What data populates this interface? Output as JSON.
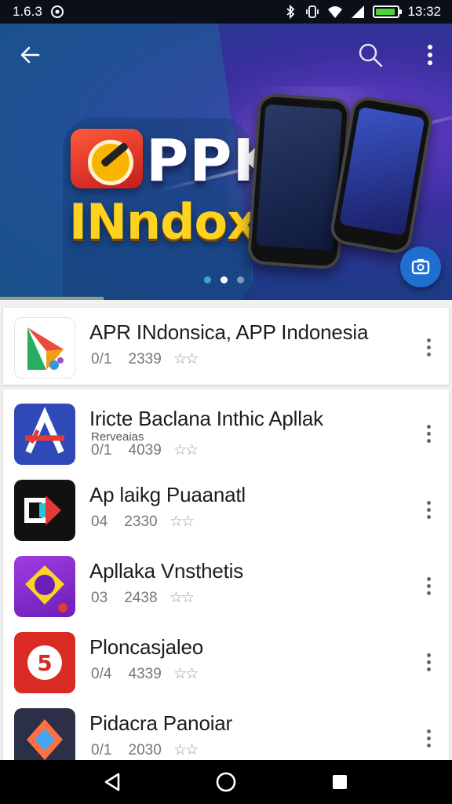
{
  "status_bar": {
    "left_text": "1.6.3",
    "time": "13:32",
    "icons": [
      "notification-icon",
      "bluetooth-icon",
      "vibrate-icon",
      "wifi-icon",
      "signal-icon",
      "battery-icon"
    ],
    "battery_level": 0.9,
    "battery_color": "#4cd137"
  },
  "banner": {
    "title": "PPK",
    "subtitle": "INndoxngia",
    "active_slide": 2,
    "slide_count": 3,
    "colors": {
      "title": "#ffffff",
      "subtitle": "#ffd21f",
      "background": "#1f3a8a",
      "fab": "#1f6fd1"
    }
  },
  "toolbar": {
    "back_icon": "arrow-left-icon",
    "search_icon": "search-icon",
    "menu_icon": "more-vert-icon",
    "fab_icon": "camera-switch-icon"
  },
  "featured_app": {
    "name": "APR INdonsica, APP Indonesia",
    "rating": "0/1",
    "count": "2339",
    "stars": "☆☆"
  },
  "apps": [
    {
      "name": "Iricte Baclana Inthic Apllak",
      "sub": "Rerveaias",
      "rating": "0/1",
      "count": "4039",
      "stars": "☆☆",
      "icon": "letter-a-icon"
    },
    {
      "name": "Ap laikg Puaanatl",
      "rating": "04",
      "count": "2330",
      "stars": "☆☆",
      "icon": "play-arrow-icon"
    },
    {
      "name": "Apllaka Vnsthetis",
      "rating": "03",
      "count": "2438",
      "stars": "☆☆",
      "icon": "circle-badge-icon"
    },
    {
      "name": "Ploncasjaleo",
      "rating": "0/4",
      "count": "4339",
      "stars": "☆☆",
      "icon": "number-five-icon"
    },
    {
      "name": "Pidacra Panoiar",
      "rating": "0/1",
      "count": "2030",
      "stars": "☆☆",
      "icon": "diamond-icon"
    }
  ],
  "nav_bar": {
    "back": "nav-back-icon",
    "home": "nav-home-icon",
    "recents": "nav-recents-icon"
  }
}
